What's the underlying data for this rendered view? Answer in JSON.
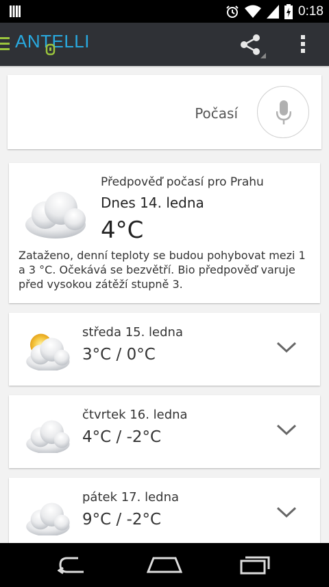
{
  "status_bar": {
    "time": "0:18"
  },
  "app_bar": {
    "logo_text": "ANTELLI"
  },
  "search": {
    "label": "Počasí"
  },
  "today": {
    "forecast_for": "Předpověď počasí pro Prahu",
    "date": "Dnes 14. ledna",
    "temp": "4°C",
    "description": "Zataženo, denní teploty se budou pohybovat mezi 1 a 3 °C. Očekává se bezvětří. Bio předpověď varuje před vysokou zátěží stupně 3."
  },
  "days": [
    {
      "name": "středa 15. ledna",
      "temps": "3°C / 0°C",
      "icon": "partly-sunny-cloud-icon"
    },
    {
      "name": "čtvrtek 16. ledna",
      "temps": "4°C / -2°C",
      "icon": "cloud-icon"
    },
    {
      "name": "pátek 17. ledna",
      "temps": "9°C / -2°C",
      "icon": "cloud-icon"
    }
  ],
  "colors": {
    "app_bar": "#2f3136",
    "logo": "#29a9df",
    "accent_green": "#9bc53d",
    "background": "#f2f2f2"
  }
}
